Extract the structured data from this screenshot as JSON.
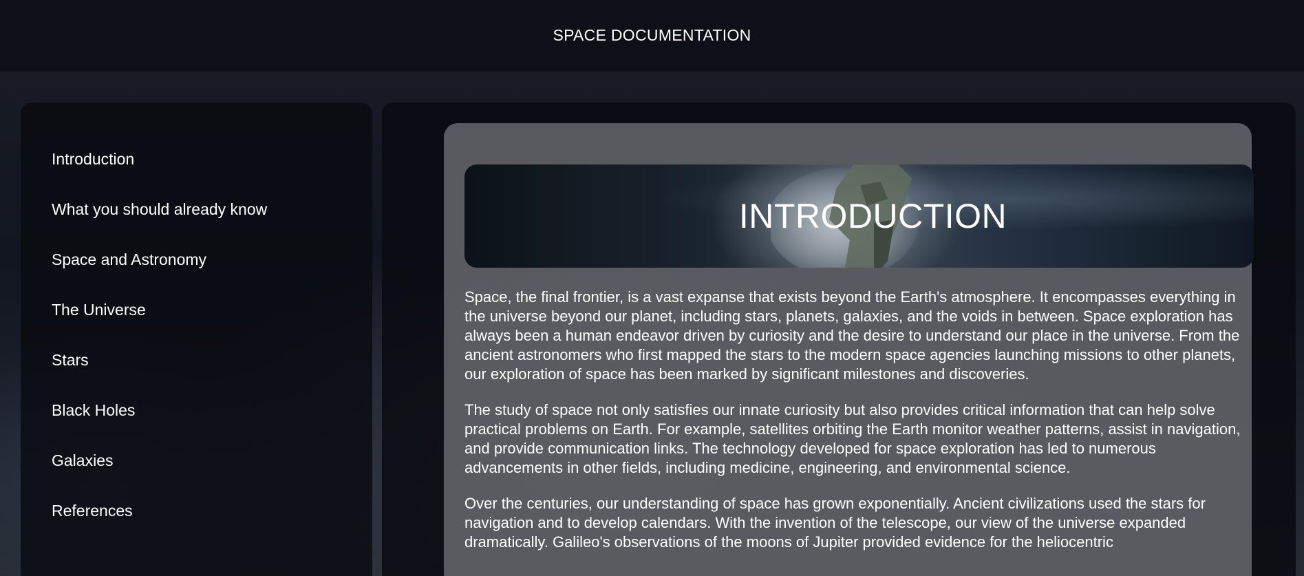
{
  "header": {
    "title": "SPACE DOCUMENTATION"
  },
  "sidebar": {
    "items": [
      {
        "label": "Introduction"
      },
      {
        "label": "What you should already know"
      },
      {
        "label": "Space and Astronomy"
      },
      {
        "label": "The Universe"
      },
      {
        "label": "Stars"
      },
      {
        "label": "Black Holes"
      },
      {
        "label": "Galaxies"
      },
      {
        "label": "References"
      }
    ]
  },
  "main": {
    "section_title": "INTRODUCTION",
    "banner_image": "astronaut-in-space-icon",
    "paragraphs": [
      "Space, the final frontier, is a vast expanse that exists beyond the Earth's atmosphere. It encompasses everything in the universe beyond our planet, including stars, planets, galaxies, and the voids in between. Space exploration has always been a human endeavor driven by curiosity and the desire to understand our place in the universe. From the ancient astronomers who first mapped the stars to the modern space agencies launching missions to other planets, our exploration of space has been marked by significant milestones and discoveries.",
      "The study of space not only satisfies our innate curiosity but also provides critical information that can help solve practical problems on Earth. For example, satellites orbiting the Earth monitor weather patterns, assist in navigation, and provide communication links. The technology developed for space exploration has led to numerous advancements in other fields, including medicine, engineering, and environmental science.",
      "Over the centuries, our understanding of space has grown exponentially. Ancient civilizations used the stars for navigation and to develop calendars. With the invention of the telescope, our view of the universe expanded dramatically. Galileo's observations of the moons of Jupiter provided evidence for the heliocentric"
    ]
  }
}
